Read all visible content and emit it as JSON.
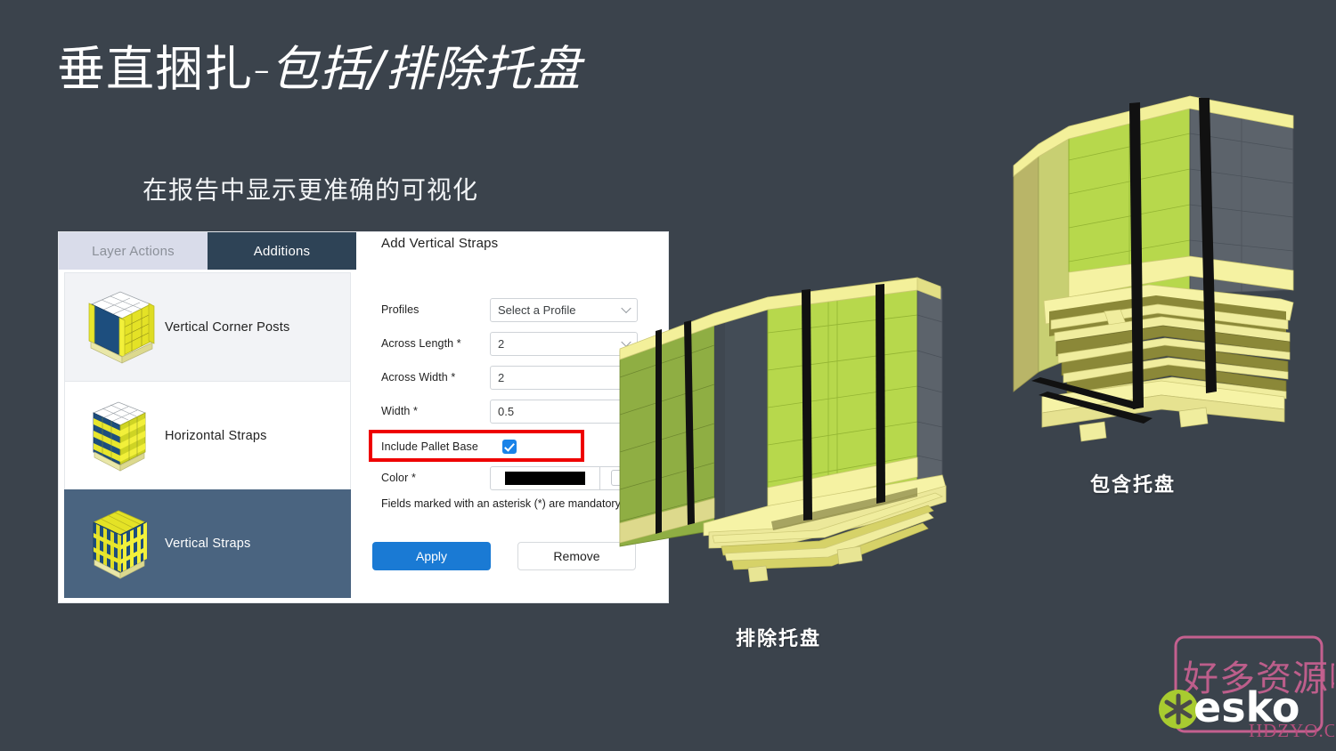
{
  "slide": {
    "title_plain": "垂直捆扎",
    "title_dash": "-",
    "title_italic": "包括/排除托盘",
    "subtitle": "在报告中显示更准确的可视化",
    "caption_exclude": "排除托盘",
    "caption_include": "包含托盘",
    "background_color": "#3b434c"
  },
  "panel": {
    "tabs": [
      {
        "label": "Layer Actions",
        "active": false
      },
      {
        "label": "Additions",
        "active": true
      }
    ],
    "additions": [
      {
        "label": "Vertical Corner Posts",
        "icon": "pallet-corner-posts-icon",
        "state": "shaded"
      },
      {
        "label": "Horizontal Straps",
        "icon": "pallet-horizontal-straps-icon",
        "state": "normal"
      },
      {
        "label": "Vertical Straps",
        "icon": "pallet-vertical-straps-icon",
        "state": "selected"
      }
    ]
  },
  "form": {
    "title": "Add Vertical Straps",
    "fields": {
      "profiles": {
        "label": "Profiles",
        "value": "Select a Profile",
        "type": "select"
      },
      "across_length": {
        "label": "Across Length *",
        "value": "2",
        "type": "select"
      },
      "across_width": {
        "label": "Across Width *",
        "value": "2",
        "type": "select"
      },
      "width": {
        "label": "Width *",
        "value": "0.5",
        "type": "text"
      },
      "include_pallet_base": {
        "label": "Include Pallet Base",
        "checked": true,
        "type": "checkbox",
        "highlight_color": "#ee0000"
      },
      "color": {
        "label": "Color *",
        "value": "#000000",
        "type": "color"
      }
    },
    "note": "Fields marked with an asterisk (*) are mandatory.",
    "buttons": {
      "apply": {
        "label": "Apply",
        "color": "#1a7ad4"
      },
      "remove": {
        "label": "Remove"
      }
    }
  },
  "renders": {
    "exclude": {
      "name": "pallet-render-straps-exclude-base",
      "strap_color": "#111111",
      "case_color": "#b5d64a",
      "pallet_color": "#f2f08a"
    },
    "include": {
      "name": "pallet-render-straps-include-base",
      "strap_color": "#111111",
      "case_color": "#b5d64a",
      "pallet_color": "#f2f08a"
    }
  },
  "watermark": {
    "chinese": "好多资源哦",
    "brand": "esko",
    "domain": "HDZYO.COM",
    "frame_color": "#c4608f",
    "mark_color": "#a8cb30"
  }
}
